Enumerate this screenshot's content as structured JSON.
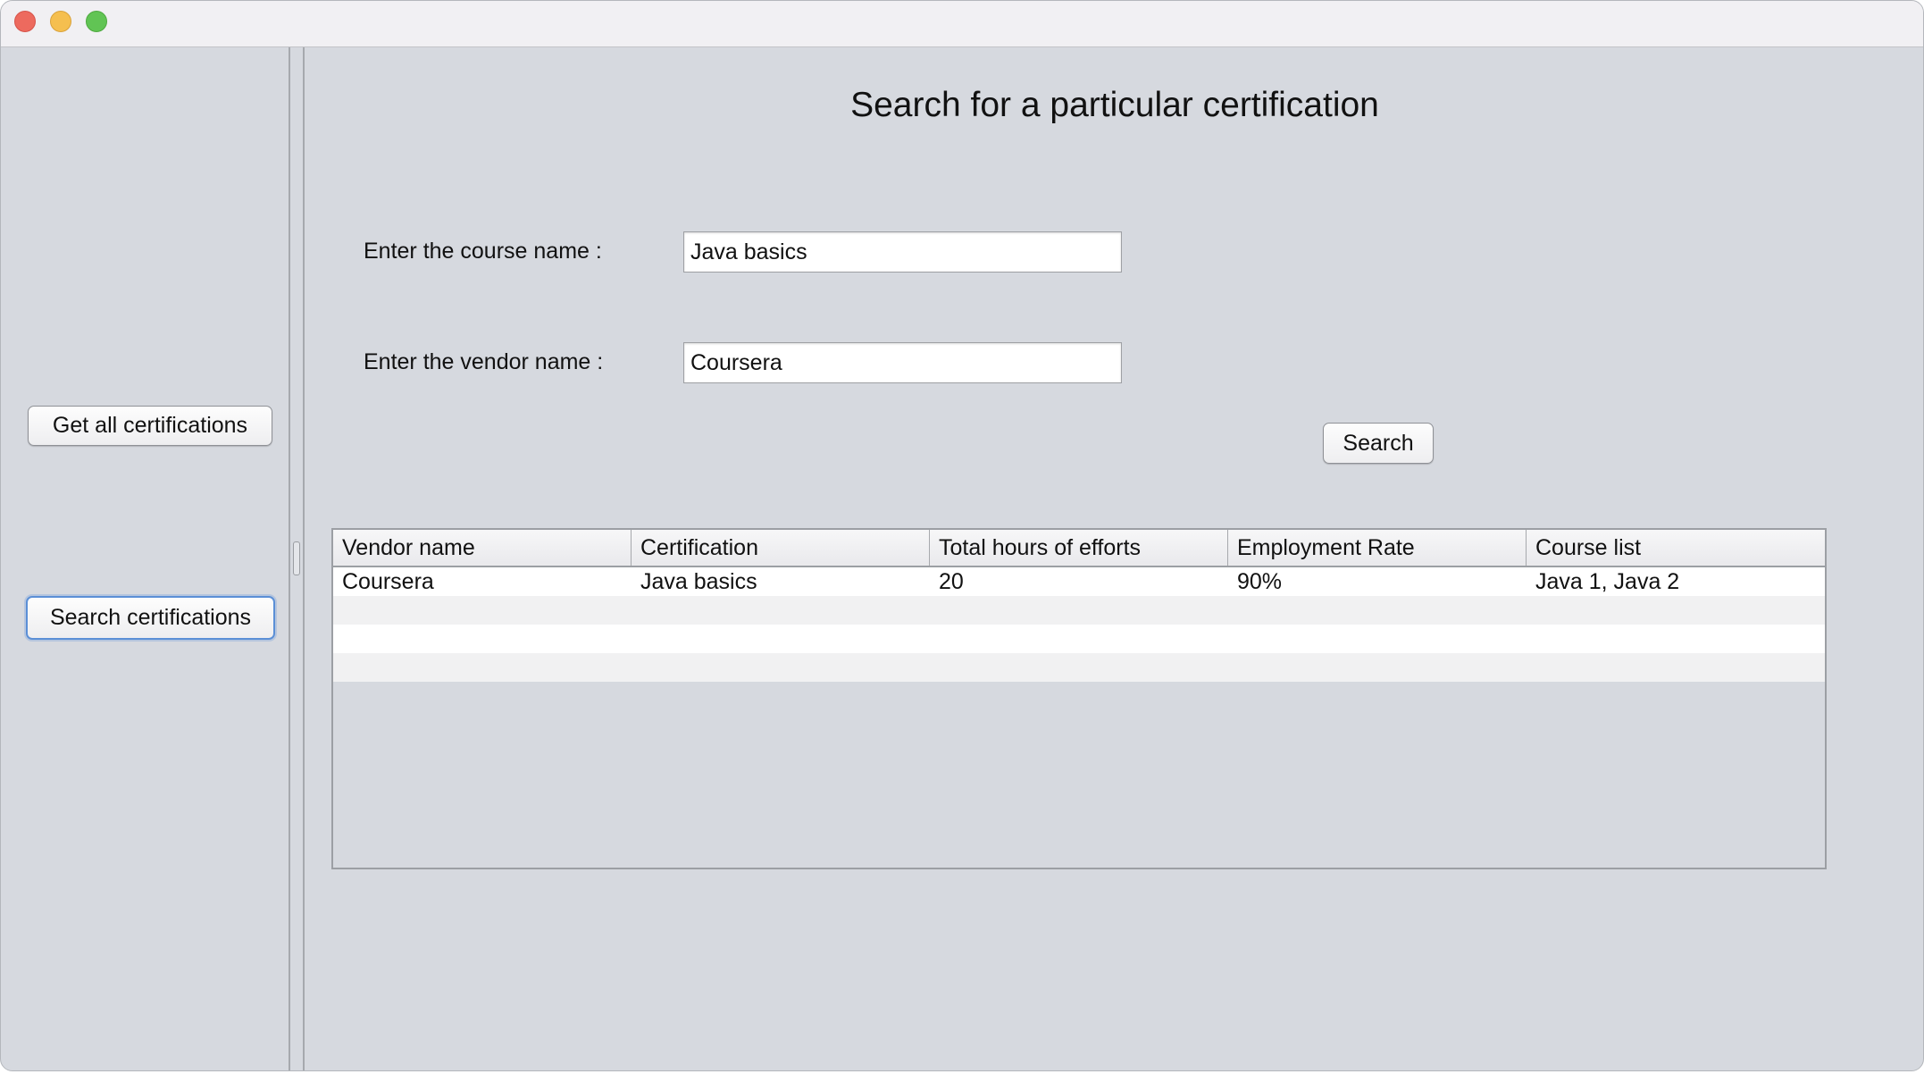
{
  "window": {
    "controls": [
      "close",
      "minimize",
      "zoom"
    ]
  },
  "sidebar": {
    "get_all_label": "Get all certifications",
    "search_certs_label": "Search certifications"
  },
  "main": {
    "title": "Search for a particular certification",
    "course_label": "Enter the course name :",
    "course_value": "Java basics",
    "vendor_label": "Enter the vendor name :",
    "vendor_value": "Coursera",
    "search_label": "Search"
  },
  "table": {
    "columns": [
      "Vendor name",
      "Certification",
      "Total hours of efforts",
      "Employment Rate",
      "Course list"
    ],
    "rows": [
      [
        "Coursera",
        "Java basics",
        "20",
        "90%",
        "Java 1, Java 2"
      ],
      [
        "",
        "",
        "",
        "",
        ""
      ],
      [
        "",
        "",
        "",
        "",
        ""
      ],
      [
        "",
        "",
        "",
        "",
        ""
      ]
    ]
  },
  "colors": {
    "background": "#d6d9df",
    "titlebar": "#f1f0f3",
    "close": "#ed6a5e",
    "minimize": "#f5bf4f",
    "zoom": "#61c454",
    "focus_ring": "#5b8fd6"
  }
}
